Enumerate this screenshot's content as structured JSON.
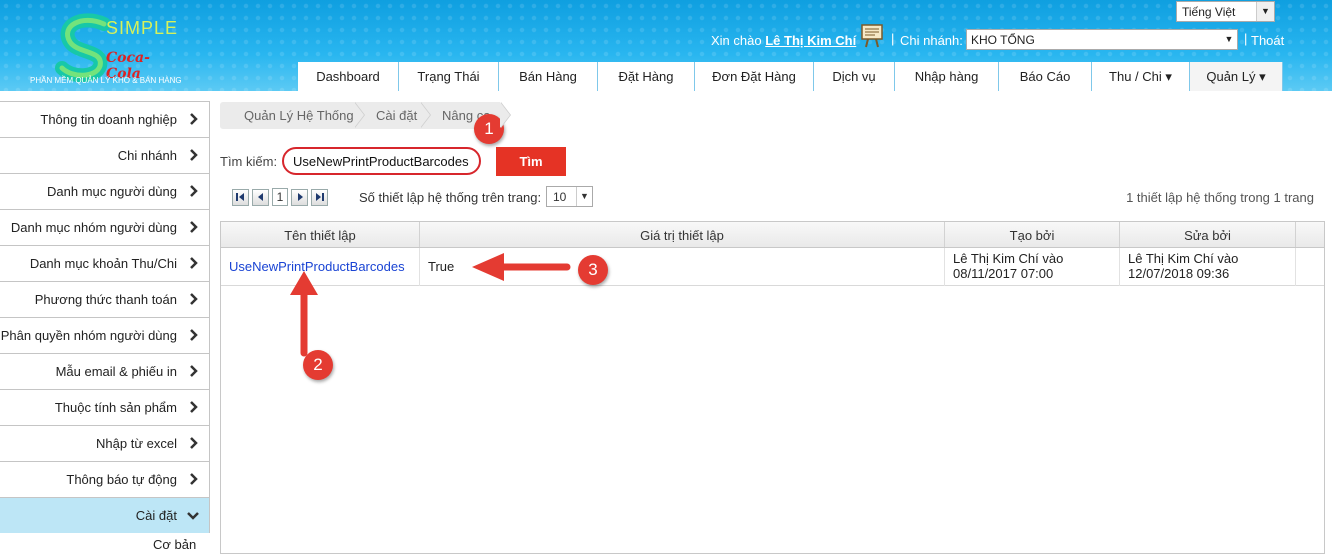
{
  "header": {
    "logo_text": "SIMPLE",
    "logo_sponsor": "Coca-Cola",
    "logo_tagline": "PHẦN MỀM QUẢN LÝ KHO & BÁN HÀNG",
    "language": "Tiếng Việt",
    "greeting": "Xin chào",
    "user_name": "Lê Thị Kim Chí",
    "branch_label": "Chi nhánh:",
    "branch_value": "KHO TỔNG",
    "logout": "Thoát"
  },
  "nav": [
    {
      "label": "Dashboard"
    },
    {
      "label": "Trạng Thái"
    },
    {
      "label": "Bán Hàng"
    },
    {
      "label": "Đặt Hàng"
    },
    {
      "label": "Đơn Đặt Hàng"
    },
    {
      "label": "Dịch vụ"
    },
    {
      "label": "Nhập hàng"
    },
    {
      "label": "Báo Cáo"
    },
    {
      "label": "Thu / Chi ▾"
    },
    {
      "label": "Quản Lý ▾"
    }
  ],
  "sidebar": {
    "items": [
      {
        "label": "Thông tin doanh nghiệp"
      },
      {
        "label": "Chi nhánh"
      },
      {
        "label": "Danh mục người dùng"
      },
      {
        "label": "Danh mục nhóm người dùng"
      },
      {
        "label": "Danh mục khoản Thu/Chi"
      },
      {
        "label": "Phương thức thanh toán"
      },
      {
        "label": "Phân quyền nhóm người dùng"
      },
      {
        "label": "Mẫu email & phiếu in"
      },
      {
        "label": "Thuộc tính sản phẩm"
      },
      {
        "label": "Nhập từ excel"
      },
      {
        "label": "Thông báo tự động"
      },
      {
        "label": "Cài đặt"
      }
    ],
    "sub_item": "Cơ bản"
  },
  "breadcrumb": [
    "Quản Lý Hệ Thống",
    "Cài đặt",
    "Nâng ca"
  ],
  "search": {
    "label": "Tìm kiếm:",
    "value": "UseNewPrintProductBarcodes",
    "button": "Tìm"
  },
  "pager": {
    "current_page": "1",
    "per_page_label": "Số thiết lập hệ thống trên trang:",
    "per_page_value": "10",
    "info": "1 thiết lập hệ thống trong 1 trang"
  },
  "table": {
    "headers": [
      "Tên thiết lập",
      "Giá trị thiết lập",
      "Tạo bởi",
      "Sửa bởi"
    ],
    "rows": [
      {
        "name": "UseNewPrintProductBarcodes",
        "value": "True",
        "created_by": "Lê Thị Kim Chí vào",
        "created_at": "08/11/2017 07:00",
        "modified_by": "Lê Thị Kim Chí vào",
        "modified_at": "12/07/2018 09:36"
      }
    ]
  },
  "annotations": [
    "1",
    "2",
    "3"
  ],
  "colors": {
    "header_blue": "#29b6f0",
    "search_button": "#e53325",
    "annotation_red": "#e43b32",
    "link_blue": "#1a44d4",
    "sidebar_active": "#bde6f6"
  }
}
